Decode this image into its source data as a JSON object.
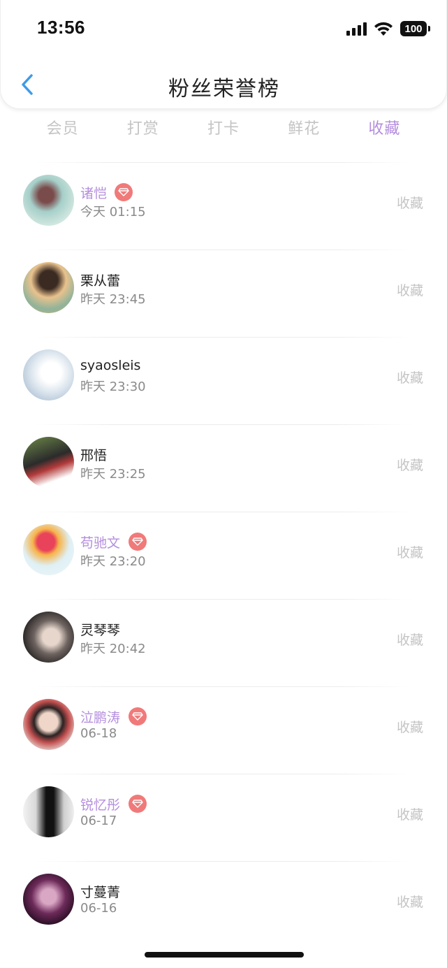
{
  "status_bar": {
    "time": "13:56",
    "battery": "100"
  },
  "nav": {
    "title": "粉丝荣誉榜"
  },
  "tabs": [
    {
      "label": "会员"
    },
    {
      "label": "打赏"
    },
    {
      "label": "打卡"
    },
    {
      "label": "鲜花"
    },
    {
      "label": "收藏",
      "active": true
    }
  ],
  "colors": {
    "accent": "#b48ede",
    "badge": "#f07a7a",
    "muted": "#c4c4c4",
    "date": "#8a8a8a"
  },
  "fans": [
    {
      "name": "诸恺",
      "vip": true,
      "date": "今天 01:15",
      "action": "收藏"
    },
    {
      "name": "栗从蕾",
      "vip": false,
      "date": "昨天 23:45",
      "action": "收藏"
    },
    {
      "name": "syaosleis",
      "vip": false,
      "date": "昨天 23:30",
      "action": "收藏"
    },
    {
      "name": "邢悟",
      "vip": false,
      "date": "昨天 23:25",
      "action": "收藏"
    },
    {
      "name": "苟驰文",
      "vip": true,
      "date": "昨天 23:20",
      "action": "收藏"
    },
    {
      "name": "灵琴琴",
      "vip": false,
      "date": "昨天 20:42",
      "action": "收藏"
    },
    {
      "name": "泣鹏涛",
      "vip": true,
      "date": "06-18",
      "action": "收藏"
    },
    {
      "name": "锐忆彤",
      "vip": true,
      "date": "06-17",
      "action": "收藏"
    },
    {
      "name": "寸蔓菁",
      "vip": false,
      "date": "06-16",
      "action": "收藏"
    }
  ]
}
